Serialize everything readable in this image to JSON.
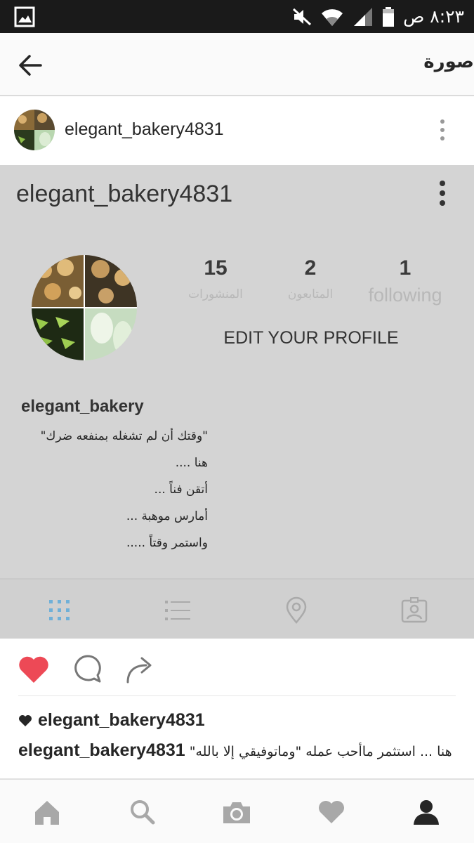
{
  "status_bar": {
    "time": "٨:٢٣ ص"
  },
  "header": {
    "title": "صورة"
  },
  "post": {
    "username": "elegant_bakery4831",
    "likes_username": "elegant_bakery4831",
    "caption_username": "elegant_bakery4831",
    "caption_text": "هنا ... استثمر ماأحب عمله \"وماتوفيقي إلا بالله\""
  },
  "profile": {
    "username": "elegant_bakery4831",
    "full_name": "elegant_bakery",
    "stats": [
      {
        "value": "15",
        "label": "المنشورات"
      },
      {
        "value": "2",
        "label": "المتابعون"
      },
      {
        "value": "1",
        "label": "following"
      }
    ],
    "edit_label": "EDIT YOUR PROFILE",
    "bio": [
      "\"وقتك أن لم تشغله بمنفعه ضرك\"",
      "هنا ....",
      "أتقن فناً ...",
      "أمارس موهبة ...",
      "واستمر وقتاً ....."
    ]
  },
  "colors": {
    "like": "#ed4956",
    "grid_active": "#3897f0",
    "grey_panel": "#d4d4d4"
  }
}
